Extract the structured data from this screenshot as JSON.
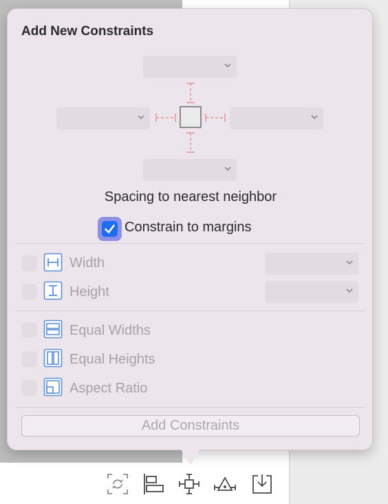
{
  "popover": {
    "title": "Add New Constraints",
    "spacing_label": "Spacing to nearest neighbor",
    "constrain_to_margins": {
      "label": "Constrain to margins",
      "checked": true
    },
    "rows": {
      "width": {
        "label": "Width",
        "icon": "width-icon"
      },
      "height": {
        "label": "Height",
        "icon": "height-icon"
      },
      "equal_widths": {
        "label": "Equal Widths",
        "icon": "equal-widths-icon"
      },
      "equal_heights": {
        "label": "Equal Heights",
        "icon": "equal-heights-icon"
      },
      "aspect_ratio": {
        "label": "Aspect Ratio",
        "icon": "aspect-ratio-icon"
      }
    },
    "add_button": "Add Constraints"
  },
  "toolbar": {
    "icons": [
      "update-frames-icon",
      "align-icon",
      "add-constraints-icon",
      "resolve-issues-icon",
      "embed-in-icon"
    ]
  },
  "colors": {
    "popover_bg": "#ece5ec",
    "checkbox_accent": "#1e6cf0",
    "guide_red": "#e8a0a8",
    "icon_blue": "#5d8fd6"
  }
}
